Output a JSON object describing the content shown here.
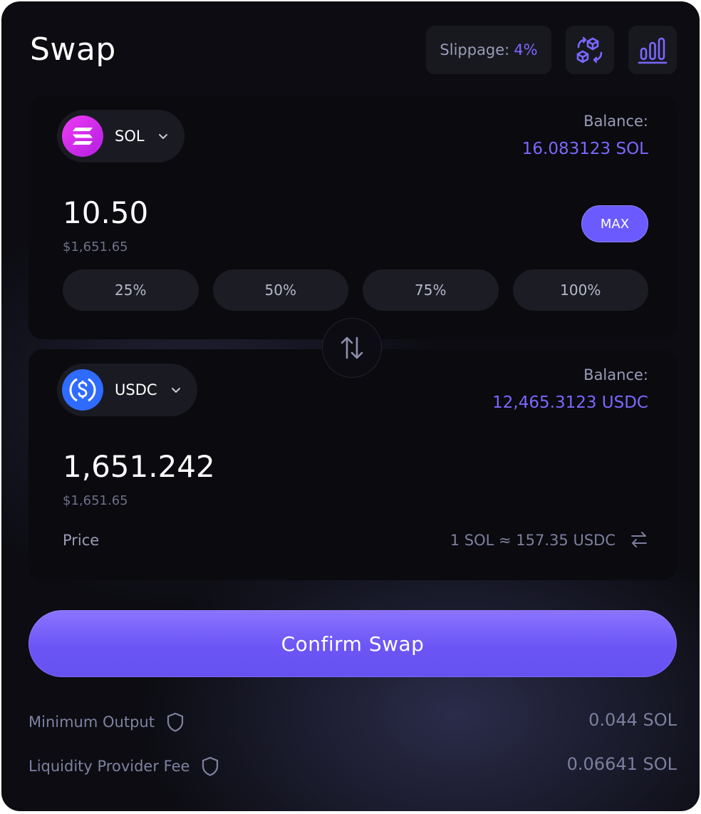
{
  "header": {
    "title": "Swap",
    "slippage_label": "Slippage:",
    "slippage_value": "4%",
    "icons": [
      "exchange-cubes-icon",
      "bar-chart-icon"
    ]
  },
  "from": {
    "token": "SOL",
    "balance_label": "Balance:",
    "balance_value": "16.083123 SOL",
    "amount": "10.50",
    "usd": "$1,651.65",
    "max_label": "MAX",
    "percent_buttons": [
      "25%",
      "50%",
      "75%",
      "100%"
    ]
  },
  "to": {
    "token": "USDC",
    "balance_label": "Balance:",
    "balance_value": "12,465.3123 USDC",
    "amount": "1,651.242",
    "usd": "$1,651.65",
    "price_label": "Price",
    "price_value": "1 SOL ≈ 157.35 USDC"
  },
  "confirm_label": "Confirm Swap",
  "details": [
    {
      "label": "Minimum Output",
      "value": "0.044 SOL"
    },
    {
      "label": "Liquidity Provider Fee",
      "value": "0.06641 SOL"
    }
  ],
  "colors": {
    "accent": "#6b5bff",
    "background": "#0c0c12",
    "panel": "#0a0a0f",
    "sol_gradient": [
      "#e040fb",
      "#9c27b0"
    ],
    "usdc_blue": "#2f6bff"
  }
}
